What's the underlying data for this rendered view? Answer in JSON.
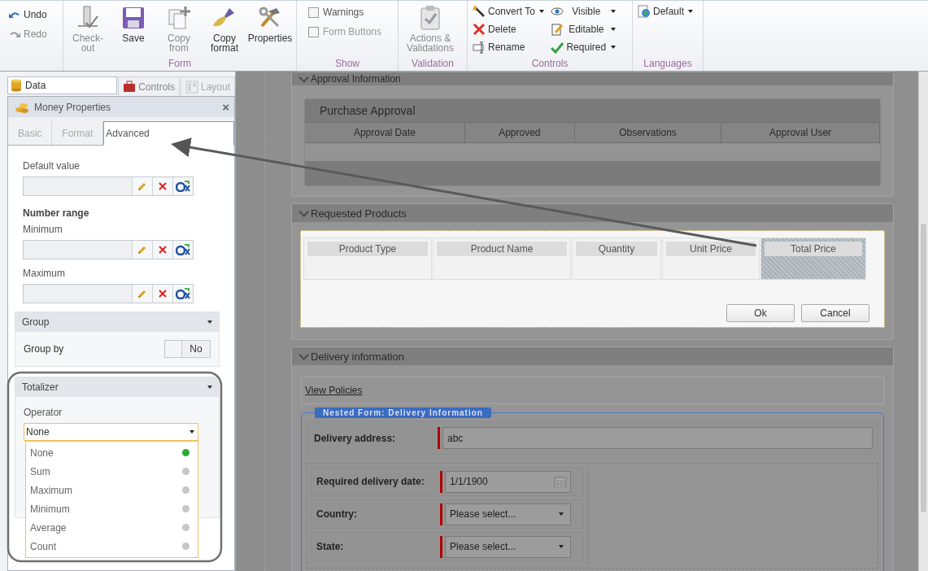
{
  "ribbon": {
    "history": [
      {
        "label": "Undo",
        "disabled": false
      },
      {
        "label": "Redo",
        "disabled": true
      }
    ],
    "form": {
      "label": "Form",
      "buttons": [
        {
          "label": "Check-out",
          "disabled": true
        },
        {
          "label": "Save",
          "disabled": false
        },
        {
          "label": "Copy from",
          "disabled": true
        },
        {
          "label": "Copy format",
          "disabled": false
        },
        {
          "label": "Properties",
          "disabled": false
        }
      ]
    },
    "show": {
      "label": "Show",
      "options": [
        {
          "label": "Warnings",
          "checked": false,
          "disabled": false
        },
        {
          "label": "Form Buttons",
          "checked": false,
          "disabled": true
        }
      ]
    },
    "validation": {
      "label": "Validation",
      "button": {
        "label": "Actions & Validations",
        "disabled": true
      }
    },
    "controls": {
      "label": "Controls",
      "actions": [
        {
          "label": "Convert To",
          "has_menu": true
        },
        {
          "label": "Delete",
          "has_menu": false
        },
        {
          "label": "Rename",
          "has_menu": false
        }
      ],
      "properties": [
        {
          "label": "Visible"
        },
        {
          "label": "Editable"
        },
        {
          "label": "Required"
        }
      ]
    },
    "languages": {
      "label": "Languages",
      "button": {
        "label": "Default"
      }
    }
  },
  "left_tabs": [
    {
      "label": "Data",
      "selected": true,
      "disabled": false
    },
    {
      "label": "Controls",
      "selected": false,
      "disabled": false
    },
    {
      "label": "Layout",
      "selected": false,
      "disabled": true
    }
  ],
  "properties_panel": {
    "title": "Money Properties",
    "close": "×",
    "tabs": [
      {
        "label": "Basic",
        "selected": false
      },
      {
        "label": "Format",
        "selected": false
      },
      {
        "label": "Advanced",
        "selected": true
      }
    ],
    "default_value": {
      "label": "Default value"
    },
    "number_range": {
      "title": "Number range",
      "fields": [
        {
          "label": "Minimum"
        },
        {
          "label": "Maximum"
        }
      ]
    },
    "group": {
      "title": "Group",
      "group_by": {
        "label": "Group by",
        "on": false,
        "value": "No"
      }
    },
    "totalizer": {
      "title": "Totalizer",
      "operator": {
        "label": "Operator",
        "value": "None",
        "options": [
          {
            "label": "None",
            "selected": true
          },
          {
            "label": "Sum",
            "selected": false
          },
          {
            "label": "Maximum",
            "selected": false
          },
          {
            "label": "Minimum",
            "selected": false
          },
          {
            "label": "Average",
            "selected": false
          },
          {
            "label": "Count",
            "selected": false
          }
        ]
      }
    }
  },
  "canvas": {
    "approval": {
      "title": "Approval Information",
      "grid_title": "Purchase Approval",
      "columns": [
        "Approval Date",
        "Approved",
        "Observations",
        "Approval User"
      ]
    },
    "requested": {
      "title": "Requested Products",
      "columns": [
        {
          "label": "Product Type",
          "selected": false
        },
        {
          "label": "Product Name",
          "selected": false
        },
        {
          "label": "Quantity",
          "selected": false
        },
        {
          "label": "Unit Price",
          "selected": false
        },
        {
          "label": "Total Price",
          "selected": true
        }
      ],
      "buttons": [
        "Ok",
        "Cancel"
      ]
    },
    "delivery": {
      "title": "Delivery information",
      "link": "View Policies",
      "nested_title": "Nested Form: Delivery Information",
      "fields": [
        {
          "label": "Delivery address:",
          "kind": "text",
          "value": "abc",
          "required": true
        },
        {
          "label": "Required delivery date:",
          "kind": "date",
          "value": "1/1/1900",
          "required": true
        },
        {
          "label": "Country:",
          "kind": "select",
          "placeholder": "Please select...",
          "required": true
        },
        {
          "label": "State:",
          "kind": "select",
          "placeholder": "Please select...",
          "required": true
        }
      ]
    }
  }
}
